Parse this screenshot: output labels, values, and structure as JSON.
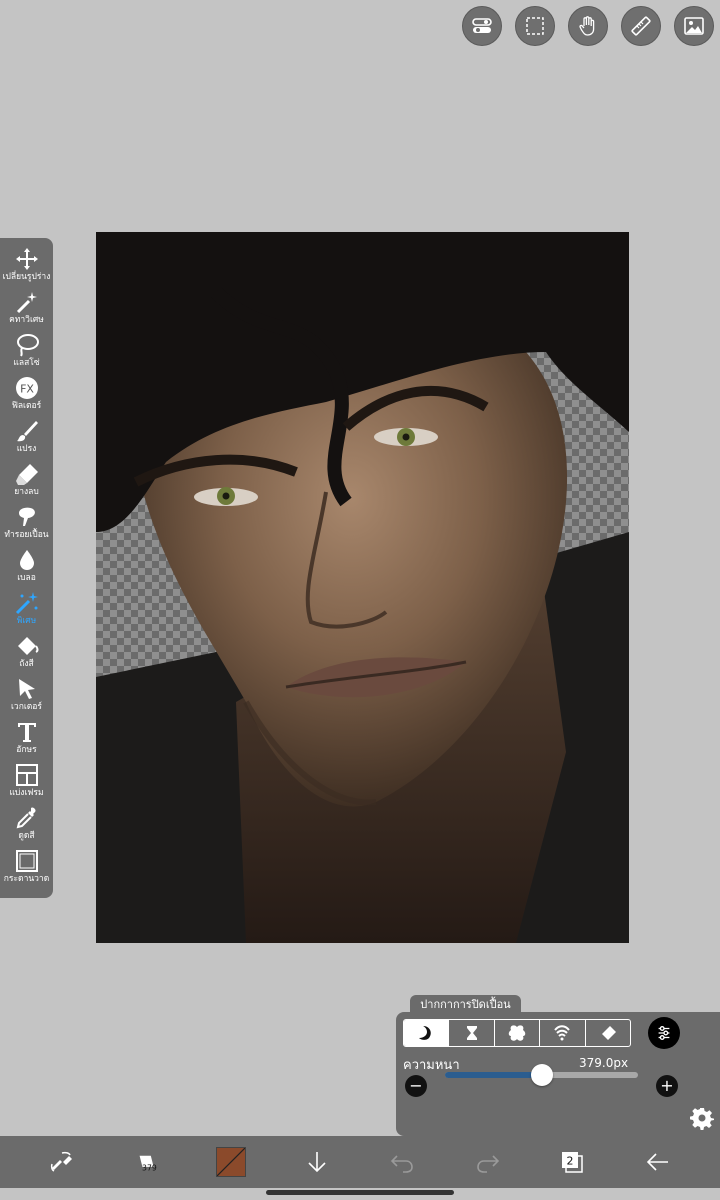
{
  "top_buttons": [
    {
      "name": "toggle-icon"
    },
    {
      "name": "selection-icon"
    },
    {
      "name": "hand-icon"
    },
    {
      "name": "ruler-icon"
    },
    {
      "name": "image-icon"
    }
  ],
  "tools": [
    {
      "name": "tool-transform",
      "icon": "move-icon",
      "label": "เปลี่ยนรูปร่าง"
    },
    {
      "name": "tool-magic-wand",
      "icon": "magic-wand-icon",
      "label": "คทาวิเศษ"
    },
    {
      "name": "tool-lasso",
      "icon": "lasso-icon",
      "label": "แลสโซ่"
    },
    {
      "name": "tool-filter",
      "icon": "fx-icon",
      "label": "ฟิลเตอร์"
    },
    {
      "name": "tool-brush",
      "icon": "brush-icon",
      "label": "แปรง"
    },
    {
      "name": "tool-eraser",
      "icon": "eraser-icon",
      "label": "ยางลบ"
    },
    {
      "name": "tool-smudge",
      "icon": "smudge-icon",
      "label": "ทำรอยเปื้อน"
    },
    {
      "name": "tool-blur",
      "icon": "drop-icon",
      "label": "เบลอ"
    },
    {
      "name": "tool-special",
      "icon": "special-brush-icon",
      "label": "พิเศษ",
      "active": true
    },
    {
      "name": "tool-fill",
      "icon": "bucket-icon",
      "label": "ถังสี"
    },
    {
      "name": "tool-vector",
      "icon": "cursor-icon",
      "label": "เวกเตอร์"
    },
    {
      "name": "tool-text",
      "icon": "text-icon",
      "label": "อักษร"
    },
    {
      "name": "tool-frame",
      "icon": "frame-divider-icon",
      "label": "แบ่งเฟรม"
    },
    {
      "name": "tool-eyedropper",
      "icon": "eyedropper-icon",
      "label": "ดูดสี"
    },
    {
      "name": "tool-canvas",
      "icon": "canvas-icon",
      "label": "กระดานวาด"
    }
  ],
  "brush_panel": {
    "title": "ปากกาการปิดเปื้อน",
    "modes": [
      "moon-icon",
      "hourglass-icon",
      "blob-icon",
      "signal-icon",
      "eraser-icon"
    ],
    "thickness_label": "ความหนา",
    "thickness_value": "379.0px",
    "slider_fraction": 0.5,
    "minus": "−",
    "plus": "+"
  },
  "bottom_bar": {
    "brush_size_label": "379",
    "layer_count": "2",
    "current_color": "#8b4a2b"
  }
}
